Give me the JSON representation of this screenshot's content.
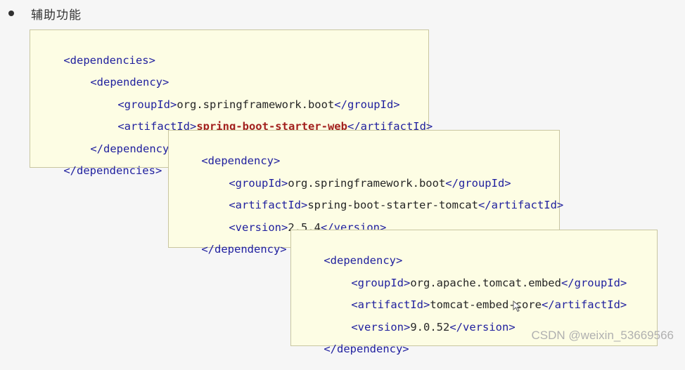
{
  "heading": {
    "title": "辅助功能"
  },
  "block1": {
    "l1_open": "<dependencies>",
    "l2_open": "<dependency>",
    "l3_open": "<groupId>",
    "l3_val": "org.springframework.boot",
    "l3_close": "</groupId>",
    "l4_open": "<artifactId>",
    "l4_val": "spring-boot-starter-web",
    "l4_close": "</artifactId>",
    "l5_close": "</dependency>",
    "l6_close": "</dependencies>"
  },
  "block2": {
    "l1_open": "<dependency>",
    "l2_open": "<groupId>",
    "l2_val": "org.springframework.boot",
    "l2_close": "</groupId>",
    "l3_open": "<artifactId>",
    "l3_val": "spring-boot-starter-tomcat",
    "l3_close": "</artifactId>",
    "l4_open": "<version>",
    "l4_val": "2.5.4",
    "l4_close": "</version>",
    "l5_close": "</dependency>"
  },
  "block3": {
    "l1_open": "<dependency>",
    "l2_open": "<groupId>",
    "l2_val": "org.apache.tomcat.embed",
    "l2_close": "</groupId>",
    "l3_open": "<artifactId>",
    "l3_val": "tomcat-embed-core",
    "l3_close": "</artifactId>",
    "l4_open": "<version>",
    "l4_val": "9.0.52",
    "l4_close": "</version>",
    "l5_close": "</dependency>"
  },
  "watermark": "CSDN @weixin_53669566",
  "icons": {
    "bullet": "bullet-dot-icon",
    "cursor": "mouse-pointer-icon"
  }
}
